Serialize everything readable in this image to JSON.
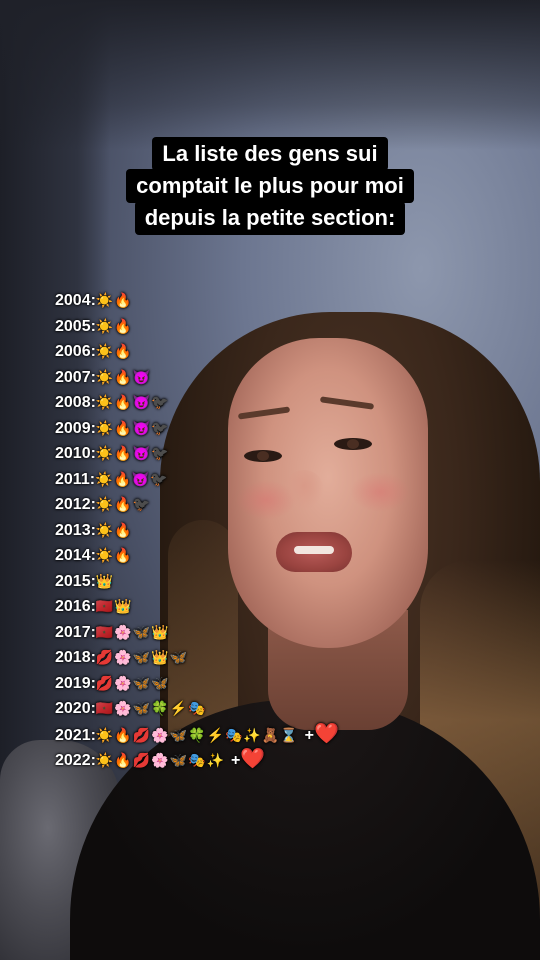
{
  "caption": {
    "lines": [
      "La liste des gens sui",
      "comptait le plus pour moi",
      "depuis la petite section:"
    ]
  },
  "years": [
    {
      "label": "2004:",
      "emojis": "☀️🔥"
    },
    {
      "label": "2005:",
      "emojis": "☀️🔥"
    },
    {
      "label": "2006:",
      "emojis": "☀️🔥"
    },
    {
      "label": "2007:",
      "emojis": "☀️🔥😈"
    },
    {
      "label": "2008:",
      "emojis": "☀️🔥😈🐦‍⬛"
    },
    {
      "label": "2009:",
      "emojis": "☀️🔥😈🐦‍⬛"
    },
    {
      "label": "2010:",
      "emojis": "☀️🔥😈🐦‍⬛"
    },
    {
      "label": "2011:",
      "emojis": "☀️🔥😈🐦‍⬛"
    },
    {
      "label": "2012:",
      "emojis": "☀️🔥🐦‍⬛"
    },
    {
      "label": "2013:",
      "emojis": "☀️🔥"
    },
    {
      "label": "2014:",
      "emojis": "☀️🔥"
    },
    {
      "label": "2015:",
      "emojis": "👑"
    },
    {
      "label": "2016:",
      "emojis": "🇲🇦👑"
    },
    {
      "label": "2017:",
      "emojis": "🇲🇦🌸🦋👑"
    },
    {
      "label": "2018:",
      "emojis": "💋🌸🦋👑🦋"
    },
    {
      "label": "2019:",
      "emojis": "💋🌸🦋🦋"
    },
    {
      "label": "2020:",
      "emojis": "🇲🇦🌸🦋🍀⚡🎭"
    },
    {
      "label": "2021:",
      "emojis": "☀️🔥💋🌸🦋🍀⚡🎭✨🧸⌛",
      "suffix": "+",
      "heart": "❤️"
    },
    {
      "label": "2022:",
      "emojis": "☀️🔥💋🌸🦋🎭✨",
      "suffix": "+",
      "heart": "❤️"
    }
  ]
}
